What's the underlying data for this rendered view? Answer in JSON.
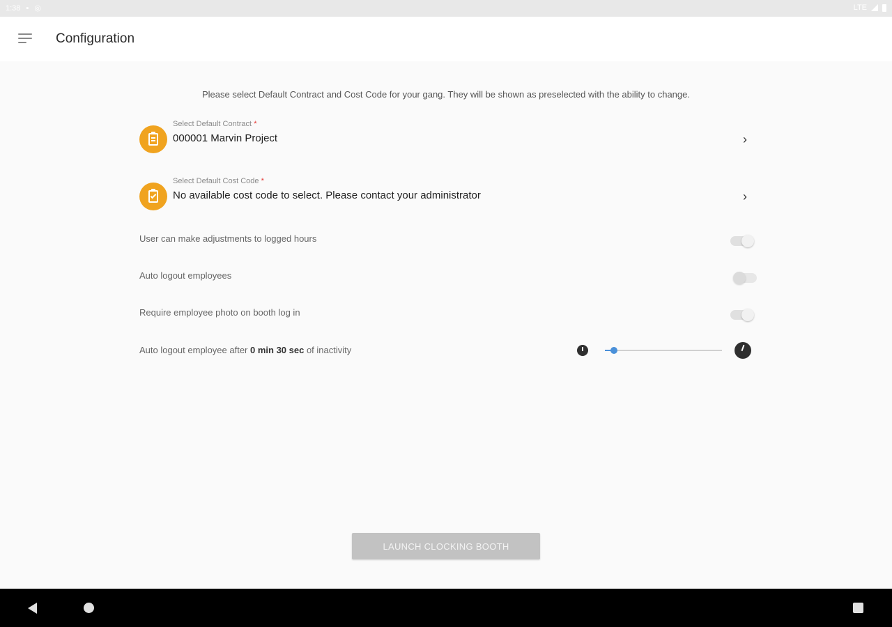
{
  "status_bar": {
    "time": "1:38",
    "network": "LTE"
  },
  "app_bar": {
    "title": "Configuration",
    "menu_icon": "hamburger-menu-icon"
  },
  "instructions": "Please select Default Contract and Cost Code for your gang. They will be shown as preselected with the ability to change.",
  "contract": {
    "label": "Select Default Contract",
    "required_mark": "*",
    "value": "000001 Marvin Project",
    "icon": "clipboard-icon",
    "accent_color": "#f0a31f"
  },
  "cost_code": {
    "label": "Select Default Cost Code",
    "required_mark": "*",
    "value": "No available cost code to select. Please contact your administrator",
    "icon": "clipboard-check-icon",
    "accent_color": "#f0a31f"
  },
  "toggles": {
    "adjust_hours": {
      "label": "User can make adjustments to logged hours",
      "state": "off"
    },
    "auto_logout": {
      "label": "Auto logout employees",
      "state": "on-disabled"
    },
    "require_photo": {
      "label": "Require employee photo on booth log in",
      "state": "off"
    }
  },
  "inactivity": {
    "prefix": "Auto logout employee after ",
    "duration": "0 min 30 sec",
    "suffix": " of inactivity",
    "slider_fraction": 0.08,
    "slider_color": "#4a90d9"
  },
  "launch_button": {
    "label": "LAUNCH CLOCKING BOOTH",
    "enabled": false
  }
}
